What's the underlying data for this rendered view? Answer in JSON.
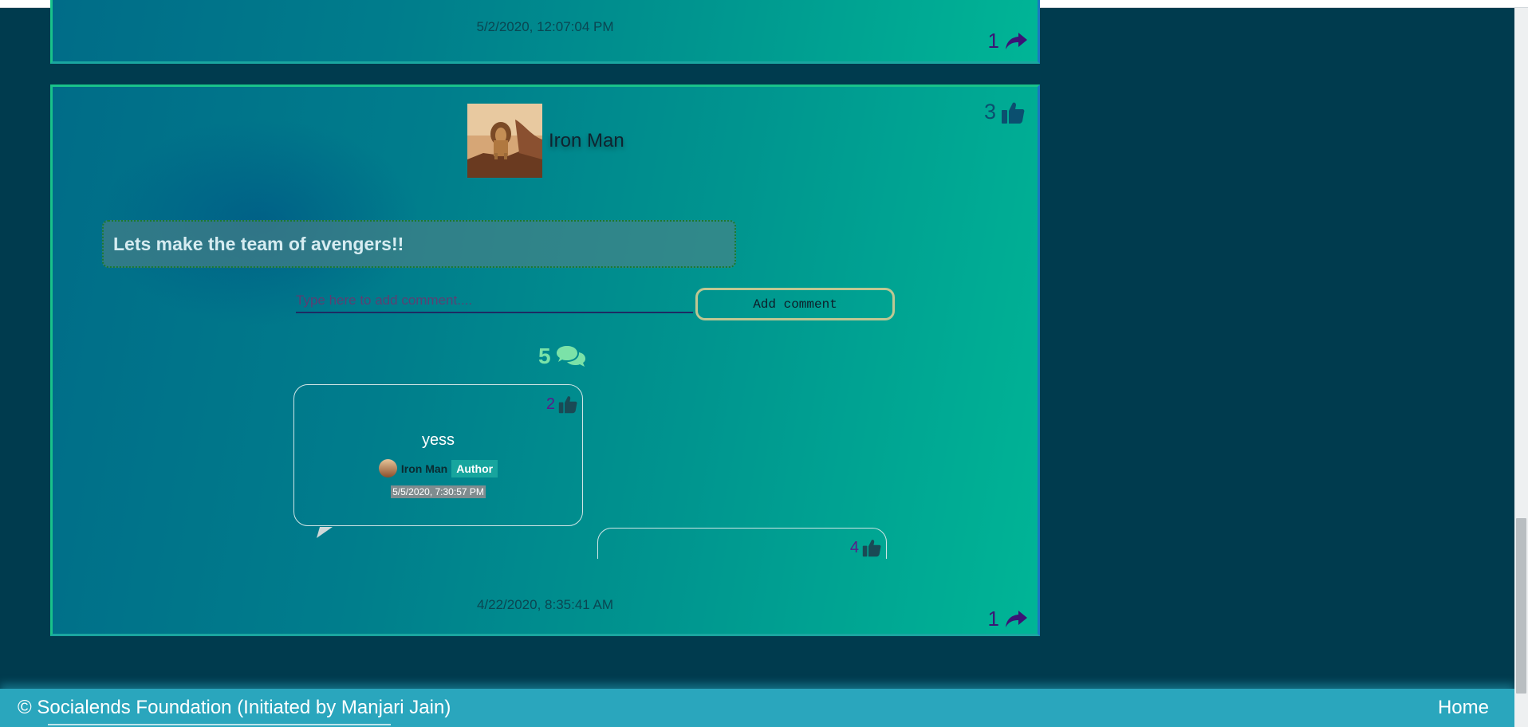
{
  "previous_post": {
    "timestamp": "5/2/2020, 12:07:04 PM",
    "share_count": "1"
  },
  "post": {
    "author_name": "Iron Man",
    "like_count": "3",
    "text": "Lets make the team of avengers!!",
    "comment_input": {
      "placeholder": "Type here to add comment....",
      "value": ""
    },
    "add_comment_label": "Add comment",
    "comment_count": "5",
    "comments": [
      {
        "like_count": "2",
        "text": "yess",
        "author": "Iron Man",
        "badge": "Author",
        "timestamp": "5/5/2020, 7:30:57 PM"
      },
      {
        "like_count": "4"
      }
    ],
    "timestamp": "4/22/2020, 8:35:41 AM",
    "share_count": "1"
  },
  "footer": {
    "copyright": "© Socialends Foundation (Initiated by Manjari Jain)",
    "home_link": "Home"
  },
  "colors": {
    "page_background": "#003b4e",
    "card_gradient_start": "#006c88",
    "card_gradient_end": "#00b596",
    "card_border": "#19c28a",
    "footer_background": "#2aa6bd",
    "share_icon": "#3b1475",
    "comment_count": "#7be2a8",
    "author_badge": "#17a59e"
  },
  "icons": {
    "share": "share-arrow-icon",
    "like": "thumbs-up-icon",
    "comments": "comments-icon"
  }
}
